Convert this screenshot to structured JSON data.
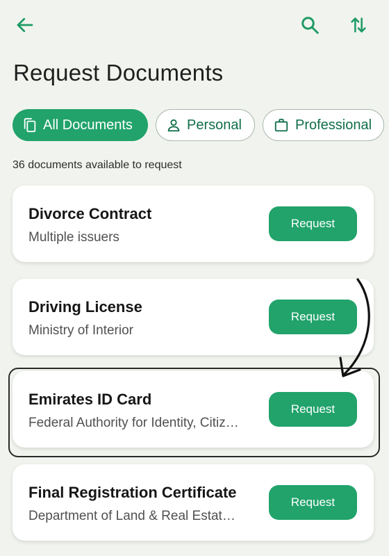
{
  "header": {
    "title": "Request Documents",
    "icons": [
      "arrow-left-icon",
      "search-icon",
      "sort-icon"
    ]
  },
  "filters": [
    {
      "label": "All Documents",
      "icon": "documents-icon",
      "selected": true
    },
    {
      "label": "Personal",
      "icon": "person-icon",
      "selected": false
    },
    {
      "label": "Professional",
      "icon": "briefcase-icon",
      "selected": false
    }
  ],
  "summary": "36 documents available to request",
  "documents": [
    {
      "title": "Divorce Contract",
      "issuer": "Multiple issuers",
      "action": "Request"
    },
    {
      "title": "Driving License",
      "issuer": "Ministry of Interior",
      "action": "Request"
    },
    {
      "title": "Emirates ID Card",
      "issuer": "Federal Authority for Identity, Citiz…",
      "action": "Request"
    },
    {
      "title": "Final Registration Certificate",
      "issuer": "Department of Land & Real Estat…",
      "action": "Request"
    }
  ],
  "colors": {
    "accent": "#21a36b",
    "accent_dark": "#0f6e47",
    "background": "#f1f4ee",
    "card": "#ffffff"
  }
}
